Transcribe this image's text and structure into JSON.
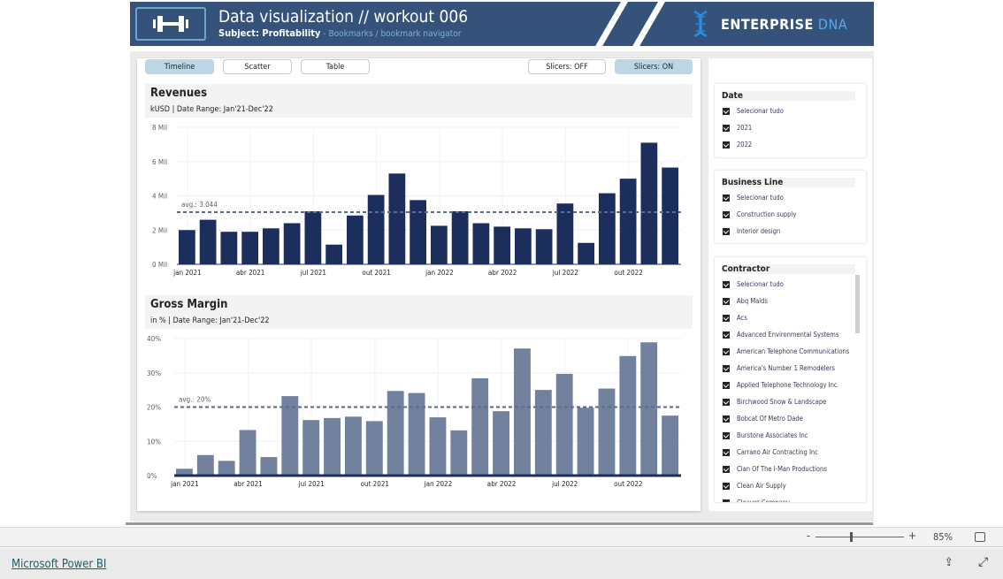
{
  "header": {
    "title": "Data visualization // workout 006",
    "subject": "Subject: Profitability",
    "subject_detail": " - Bookmarks / bookmark navigator",
    "brand_part1": "ENTERPRISE",
    "brand_part2": " DNA",
    "logo_icon": "dumbbell-icon",
    "color": "#34527a"
  },
  "nav": {
    "timeline": "Timeline",
    "scatter": "Scatter",
    "table": "Table",
    "slicers_off": "Slicers: OFF",
    "slicers_on": "Slicers: ON",
    "active": [
      "Timeline",
      "Slicers: ON"
    ]
  },
  "revenues": {
    "title": "Revenues",
    "subtitle": "kUSD | Date Range: Jan'21-Dec'22"
  },
  "gross_margin": {
    "title": "Gross Margin",
    "subtitle": "in % | Date Range: Jan'21-Dec'22"
  },
  "chart_data": [
    {
      "type": "bar",
      "title": "Revenues",
      "color": "#1b2e5c",
      "x_tick_labels": [
        "jan 2021",
        "abr 2021",
        "jul 2021",
        "out 2021",
        "jan 2022",
        "abr 2022",
        "jul 2022",
        "out 2022"
      ],
      "y_tick_labels": [
        "0 Mil",
        "2 Mil",
        "4 Mil",
        "6 Mil",
        "8 Mil"
      ],
      "ylim": [
        0,
        8
      ],
      "unit": "Mil",
      "categories": [
        "2021-01",
        "2021-02",
        "2021-03",
        "2021-04",
        "2021-05",
        "2021-06",
        "2021-07",
        "2021-08",
        "2021-09",
        "2021-10",
        "2021-11",
        "2021-12",
        "2022-01",
        "2022-02",
        "2022-03",
        "2022-04",
        "2022-05",
        "2022-06",
        "2022-07",
        "2022-08",
        "2022-09",
        "2022-10",
        "2022-11",
        "2022-12"
      ],
      "values": [
        2.0,
        2.6,
        1.9,
        1.9,
        2.1,
        2.4,
        3.1,
        1.15,
        2.85,
        4.05,
        5.3,
        3.75,
        2.25,
        3.1,
        2.4,
        2.2,
        2.1,
        2.05,
        3.55,
        1.25,
        4.15,
        5.0,
        7.1,
        5.65
      ],
      "average": 3.044,
      "average_label": "avg.: 3.044",
      "grid": true
    },
    {
      "type": "bar",
      "title": "Gross Margin",
      "color": "#72819e",
      "x_tick_labels": [
        "jan 2021",
        "abr 2021",
        "jul 2021",
        "out 2021",
        "jan 2022",
        "abr 2022",
        "jul 2022",
        "out 2022"
      ],
      "y_tick_labels": [
        "0%",
        "10%",
        "20%",
        "30%",
        "40%"
      ],
      "ylim": [
        0,
        40
      ],
      "unit": "%",
      "categories": [
        "2021-01",
        "2021-02",
        "2021-03",
        "2021-04",
        "2021-05",
        "2021-06",
        "2021-07",
        "2021-08",
        "2021-09",
        "2021-10",
        "2021-11",
        "2021-12",
        "2022-01",
        "2022-02",
        "2022-03",
        "2022-04",
        "2022-05",
        "2022-06",
        "2022-07",
        "2022-08",
        "2022-09",
        "2022-10",
        "2022-11",
        "2022-12"
      ],
      "values": [
        2,
        6,
        4.3,
        13.3,
        5.4,
        23.2,
        16.2,
        16.8,
        17.2,
        15.9,
        24.7,
        24.1,
        17,
        13.2,
        28.4,
        18.8,
        37.1,
        25,
        29.7,
        19.8,
        25.4,
        34.9,
        38.9,
        17.5
      ],
      "average": 20,
      "average_label": "avg.: 20%",
      "grid": true
    }
  ],
  "slicers": {
    "date": {
      "title": "Date",
      "items": [
        "Selecionar tudo",
        "2021",
        "2022"
      ]
    },
    "business_line": {
      "title": "Business Line",
      "items": [
        "Selecionar tudo",
        "Construction supply",
        "Interior design"
      ]
    },
    "contractor": {
      "title": "Contractor",
      "items": [
        "Selecionar tudo",
        "Abq Maids",
        "Acs",
        "Advanced Environmental Systems",
        "American Telephone Communications",
        "America's Number 1 Remodelers",
        "Applied Telephone Technology Inc",
        "Birchwood Snow & Landscape",
        "Bobcat Of Metro Dade",
        "Burstone Associates Inc",
        "Carrano Air Contracting Inc",
        "Clan Of The I-Man Productions",
        "Clean Air Supply",
        "Cleaver Company"
      ]
    }
  },
  "zoom": {
    "minus": "-",
    "plus": "+",
    "level": "85%",
    "level_fraction": 0.3
  },
  "footer": {
    "link": "Microsoft Power BI"
  }
}
